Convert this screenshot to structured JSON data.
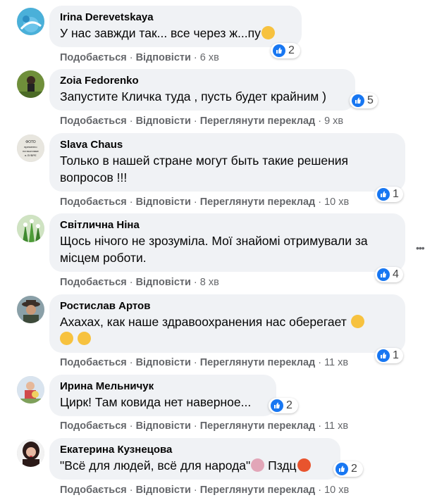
{
  "comments": [
    {
      "author": "Irina Derevetskaya",
      "text": "У нас завжди так... все через ж...пу",
      "reactions": "2",
      "like": "Подобається",
      "reply": "Відповісти",
      "translate": "",
      "time": "6 хв"
    },
    {
      "author": "Zoia Fedorenko",
      "text": "Запустите Кличка туда , пусть будет крайним )",
      "reactions": "5",
      "like": "Подобається",
      "reply": "Відповісти",
      "translate": "Переглянути переклад",
      "time": "9 хв"
    },
    {
      "author": "Slava Chaus",
      "text_line1": "Только в нашей стране могут быть такие решения",
      "text_line2": "вопросов !!!",
      "reactions": "1",
      "like": "Подобається",
      "reply": "Відповісти",
      "translate": "Переглянути переклад",
      "time": "10 хв"
    },
    {
      "author": "Світлична Ніна",
      "text_line1": "Щось нічого не зрозуміла. Мої знайомі отримували за",
      "text_line2": "місцем роботи.",
      "reactions": "4",
      "like": "Подобається",
      "reply": "Відповісти",
      "translate": "",
      "time": "8 хв"
    },
    {
      "author": "Ростислав Артов",
      "text_line1": "Ахахах, как наше здравоохранения нас оберегает",
      "reactions": "1",
      "like": "Подобається",
      "reply": "Відповісти",
      "translate": "Переглянути переклад",
      "time": "11 хв"
    },
    {
      "author": "Ирина Мельничук",
      "text": "Цирк! Там ковида нет наверное...",
      "reactions": "2",
      "like": "Подобається",
      "reply": "Відповісти",
      "translate": "Переглянути переклад",
      "time": "11 хв"
    },
    {
      "author": "Екатерина Кузнецова",
      "text": "\"Всё для людей, всё для народа\"",
      "text_after": "Пздц",
      "reactions": "2",
      "like": "Подобається",
      "reply": "Відповісти",
      "translate": "Переглянути переклад",
      "time": "10 хв"
    }
  ],
  "icons": {
    "reaction": "like-icon",
    "more": "more-options-icon"
  },
  "colors": {
    "like_blue": "#1877f2",
    "bubble": "#f0f2f5",
    "meta_text": "#65676b"
  }
}
